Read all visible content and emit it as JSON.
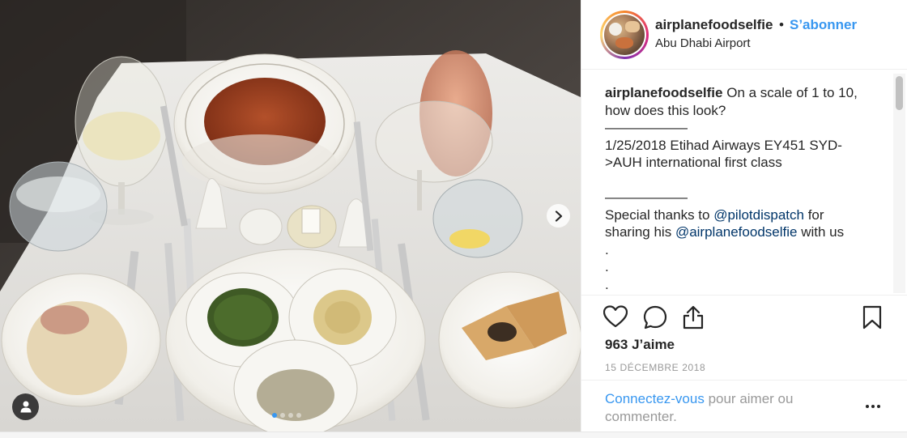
{
  "post": {
    "username": "airplanefoodselfie",
    "separator": "•",
    "follow_label": "S’abonner",
    "location": "Abu Dhabi Airport",
    "caption": {
      "user": "airplanefoodselfie",
      "line1": "On a scale of 1 to 10, how does this look?",
      "rule1": "——————",
      "line2": "1/25/2018 Etihad Airways EY451 SYD->AUH international first class",
      "rule2": "——————",
      "thanks_prefix": "Special thanks to ",
      "mention1": "@pilotdispatch",
      "thanks_middle": " for sharing his ",
      "mention2": "@airplanefoodselfie",
      "thanks_suffix": " with us",
      "dot1": ".",
      "dot2": ".",
      "dot3": "."
    },
    "likes": "963 J’aime",
    "date": "15 DÉCEMBRE 2018",
    "login_link": "Connectez-vous",
    "login_rest": " pour aimer ou commenter."
  },
  "carousel": {
    "slides": 4,
    "active_index": 0
  },
  "icons": {
    "like": "heart-icon",
    "comment": "comment-bubble-icon",
    "share": "share-icon",
    "save": "bookmark-icon",
    "next": "chevron-right-icon",
    "tag": "user-tag-icon",
    "more": "more-dots-icon"
  },
  "colors": {
    "link": "#3897f0",
    "mention": "#003569",
    "muted": "#999999",
    "text": "#262626"
  }
}
